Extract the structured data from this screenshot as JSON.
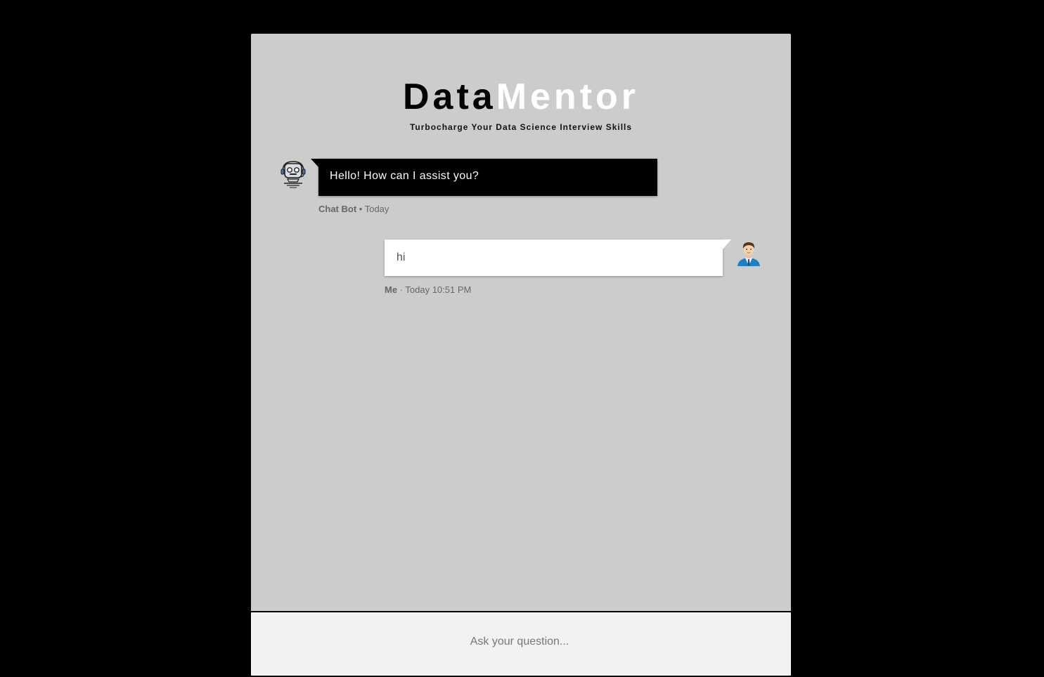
{
  "header": {
    "title_part1": "Data",
    "title_part2": "Mentor",
    "subtitle": "Turbocharge Your Data Science Interview Skills"
  },
  "messages": [
    {
      "sender": "Chat Bot",
      "text": "Hello! How can I assist you?",
      "separator": " • ",
      "time": "Today",
      "avatar_icon": "robot-icon"
    },
    {
      "sender": "Me",
      "text": "hi",
      "separator": " · ",
      "time": "Today 10:51 PM",
      "avatar_icon": "user-avatar-icon"
    }
  ],
  "input": {
    "placeholder": "Ask your question...",
    "value": ""
  },
  "colors": {
    "page_background": "#000000",
    "panel_background": "#cccccc",
    "bot_bubble": "#000000",
    "user_bubble": "#ffffff",
    "input_background": "#f2f2f2"
  }
}
